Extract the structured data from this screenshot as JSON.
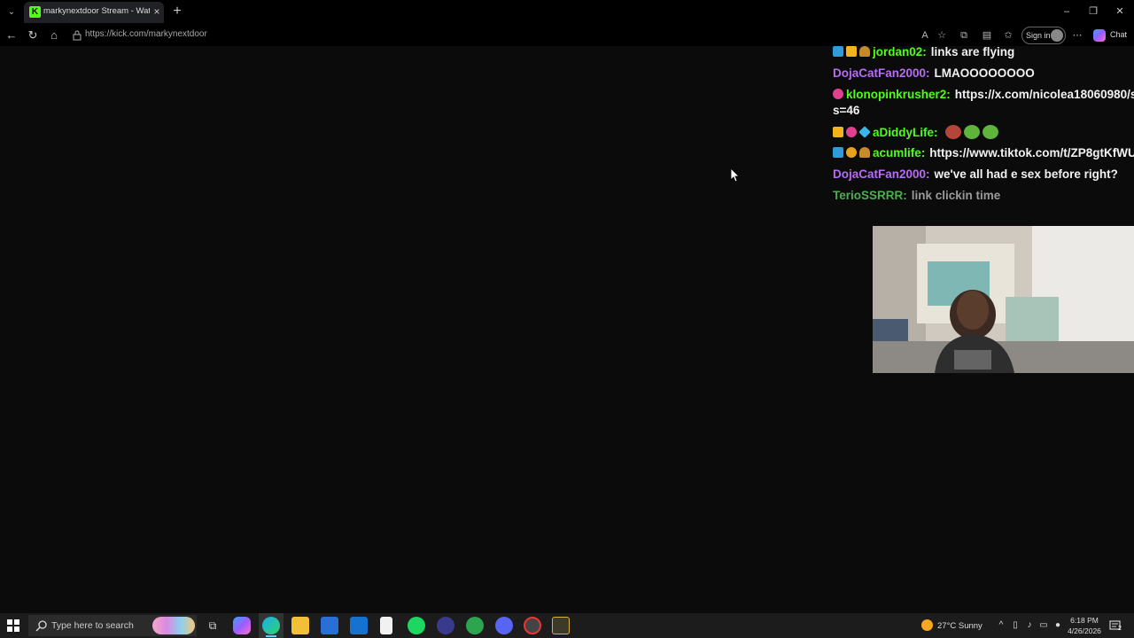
{
  "browser": {
    "tab_title": "markynextdoor Stream - Watch Li",
    "favicon_letter": "K",
    "url": "https://kick.com/markynextdoor",
    "signin_label": "Sign in",
    "chat_label": "Chat"
  },
  "chat": {
    "messages": [
      {
        "badges": [
          "blue",
          "gold",
          "taco"
        ],
        "username": "jordan02:",
        "user_color": "#53fc18",
        "text": "links are flying",
        "text_color": "#f2f2f2"
      },
      {
        "badges": [],
        "username": "DojaCatFan2000:",
        "user_color": "#b76cf5",
        "text": "LMAOOOOOOOO",
        "text_color": "#f2f2f2"
      },
      {
        "badges": [
          "pink"
        ],
        "username": "klonopinkrusher2:",
        "user_color": "#53fc18",
        "text": "https://x.com/nicolea18060980/s",
        "text_color": "#f2f2f2",
        "wrap": "s=46"
      },
      {
        "badges": [
          "gold",
          "pink",
          "cube"
        ],
        "username": "aDiddyLife:",
        "user_color": "#53fc18",
        "text": "",
        "text_color": "#f2f2f2",
        "emotes": 3
      },
      {
        "badges": [
          "blue",
          "orange",
          "taco"
        ],
        "username": "acumlife:",
        "user_color": "#53fc18",
        "text": "https://www.tiktok.com/t/ZP8gtKfWU",
        "text_color": "#f2f2f2"
      },
      {
        "badges": [],
        "username": "DojaCatFan2000:",
        "user_color": "#b76cf5",
        "text": "we've all had e sex before right?",
        "text_color": "#f2f2f2"
      },
      {
        "badges": [],
        "username": "TerioSSRRR:",
        "user_color": "#4caf50",
        "text": "link clickin time",
        "text_color": "#9a9a9a"
      }
    ]
  },
  "taskbar": {
    "search_placeholder": "Type here to search",
    "weather": "27°C  Sunny",
    "time": "6:18 PM",
    "date": "4/26/2026",
    "notification_count": "2"
  }
}
